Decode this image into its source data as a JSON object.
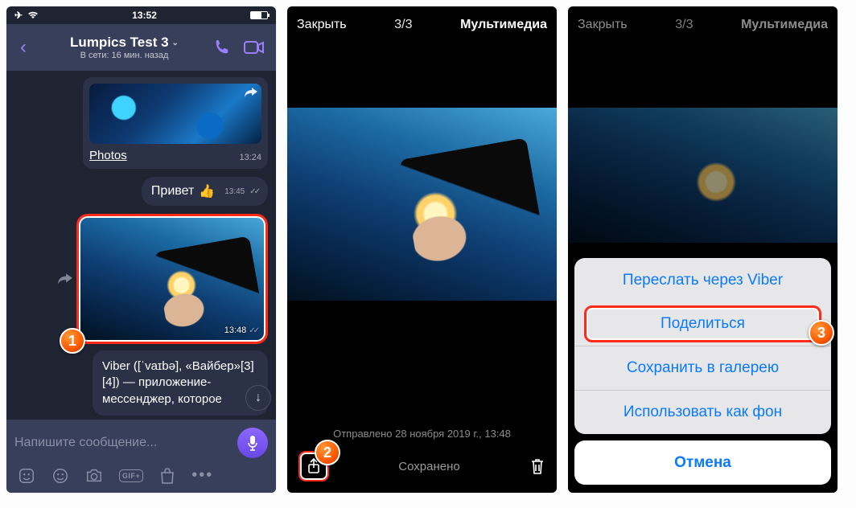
{
  "statusbar": {
    "time": "13:52"
  },
  "chat": {
    "title": "Lumpics Test 3",
    "subtitle": "В сети: 16 мин. назад",
    "link_card": {
      "label": "Photos",
      "time": "13:24"
    },
    "msg1": {
      "text": "Привет",
      "time": "13:45"
    },
    "photo": {
      "time": "13:48"
    },
    "msg2": {
      "text": "Viber ([ˈvaɪbə], «Вайбер»[3][4]) — приложение-мессенджер, которое"
    },
    "composer_placeholder": "Напишите сообщение..."
  },
  "viewer": {
    "close": "Закрыть",
    "counter": "3/3",
    "section": "Мультимедиа",
    "meta": "Отправлено 28 ноября 2019 г., 13:48",
    "saved": "Сохранено"
  },
  "sheet": {
    "forward": "Переслать через Viber",
    "share": "Поделиться",
    "save": "Сохранить в галерею",
    "wallpaper": "Использовать как фон",
    "cancel": "Отмена"
  },
  "steps": {
    "s1": "1",
    "s2": "2",
    "s3": "3"
  },
  "tool": {
    "gif": "GIF+"
  }
}
